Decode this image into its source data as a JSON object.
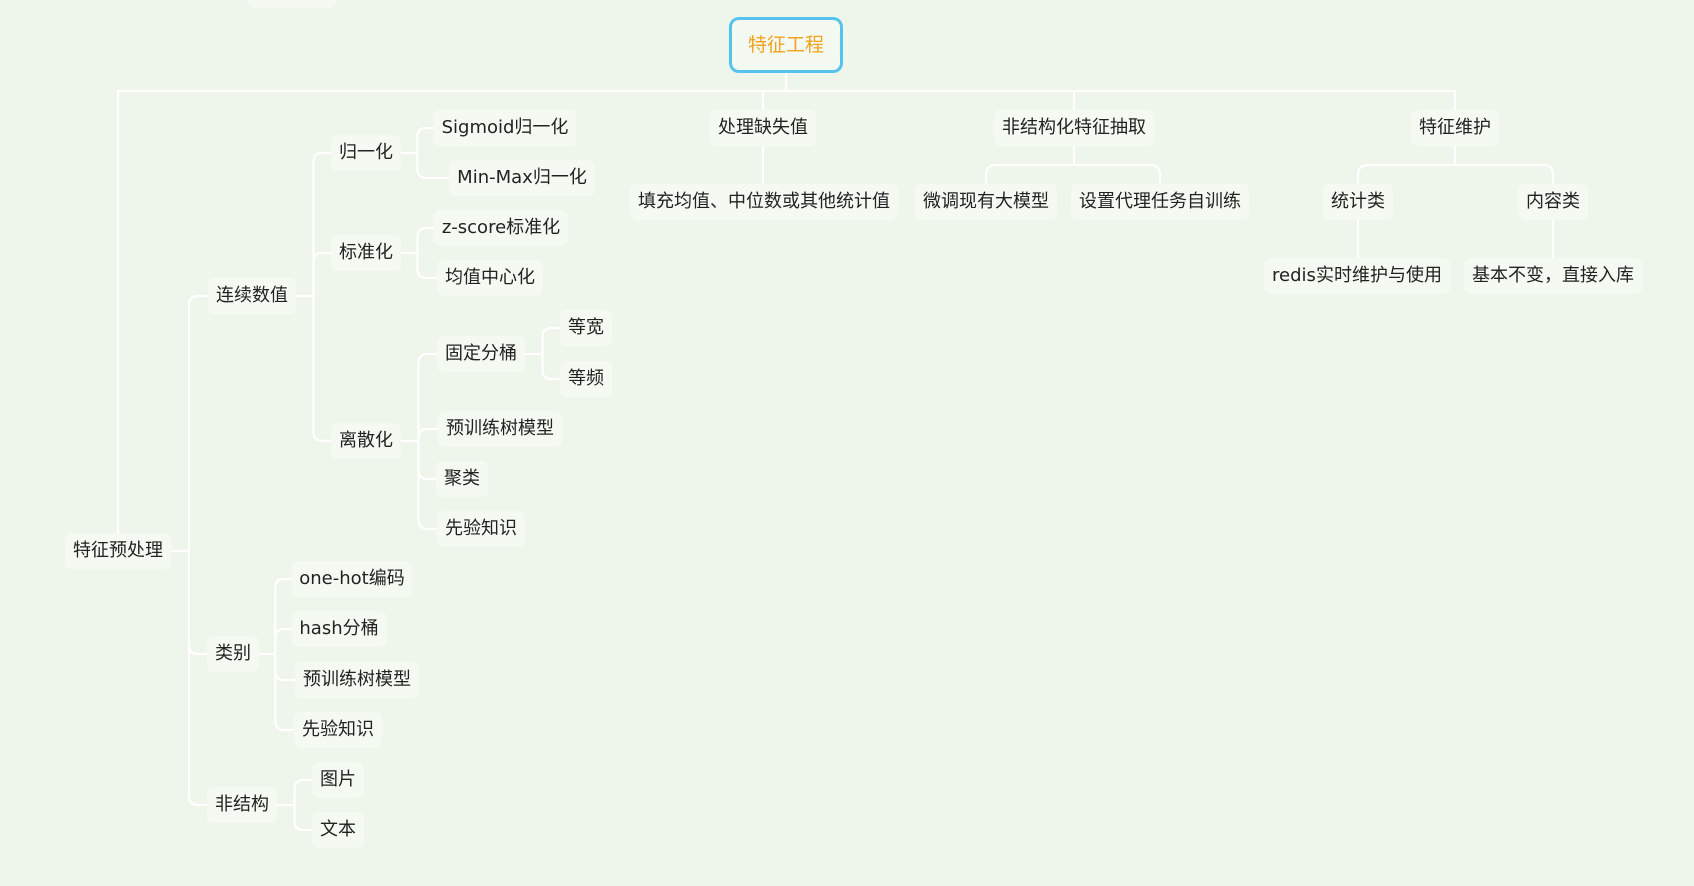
{
  "mindmap": {
    "root": "特征工程",
    "nodes": [
      {
        "id": "root",
        "label": "特征工程",
        "root": true
      },
      {
        "id": "pre",
        "label": "特征预处理",
        "parent": "root"
      },
      {
        "id": "cont",
        "label": "连续数值",
        "parent": "pre"
      },
      {
        "id": "norm",
        "label": "归一化",
        "parent": "cont"
      },
      {
        "id": "sig",
        "label": "Sigmoid归一化",
        "parent": "norm"
      },
      {
        "id": "minmax",
        "label": "Min-Max归一化",
        "parent": "norm"
      },
      {
        "id": "std",
        "label": "标准化",
        "parent": "cont"
      },
      {
        "id": "zscore",
        "label": "z-score标准化",
        "parent": "std"
      },
      {
        "id": "center",
        "label": "均值中心化",
        "parent": "std"
      },
      {
        "id": "disc",
        "label": "离散化",
        "parent": "cont"
      },
      {
        "id": "fixbin",
        "label": "固定分桶",
        "parent": "disc"
      },
      {
        "id": "eqw",
        "label": "等宽",
        "parent": "fixbin"
      },
      {
        "id": "eqf",
        "label": "等频",
        "parent": "fixbin"
      },
      {
        "id": "tree1",
        "label": "预训练树模型",
        "parent": "disc"
      },
      {
        "id": "cluster",
        "label": "聚类",
        "parent": "disc"
      },
      {
        "id": "prior1",
        "label": "先验知识",
        "parent": "disc"
      },
      {
        "id": "cat",
        "label": "类别",
        "parent": "pre"
      },
      {
        "id": "onehot",
        "label": "one-hot编码",
        "parent": "cat"
      },
      {
        "id": "hash",
        "label": "hash分桶",
        "parent": "cat"
      },
      {
        "id": "tree2",
        "label": "预训练树模型",
        "parent": "cat"
      },
      {
        "id": "prior2",
        "label": "先验知识",
        "parent": "cat"
      },
      {
        "id": "unstr",
        "label": "非结构",
        "parent": "pre"
      },
      {
        "id": "img",
        "label": "图片",
        "parent": "unstr"
      },
      {
        "id": "txt",
        "label": "文本",
        "parent": "unstr"
      },
      {
        "id": "missing",
        "label": "处理缺失值",
        "parent": "root"
      },
      {
        "id": "fill",
        "label": "填充均值、中位数或其他统计值",
        "parent": "missing"
      },
      {
        "id": "extract",
        "label": "非结构化特征抽取",
        "parent": "root"
      },
      {
        "id": "finetune",
        "label": "微调现有大模型",
        "parent": "extract"
      },
      {
        "id": "proxy",
        "label": "设置代理任务自训练",
        "parent": "extract"
      },
      {
        "id": "maint",
        "label": "特征维护",
        "parent": "root"
      },
      {
        "id": "stat",
        "label": "统计类",
        "parent": "maint"
      },
      {
        "id": "redis",
        "label": "redis实时维护与使用",
        "parent": "stat"
      },
      {
        "id": "content",
        "label": "内容类",
        "parent": "maint"
      },
      {
        "id": "stable",
        "label": "基本不变，直接入库",
        "parent": "content"
      }
    ]
  },
  "colors": {
    "background": "#eef5ea",
    "node_fill": "#f4f9f1",
    "line": "#ffffff",
    "root_border": "#55c3ee",
    "root_text": "#f2a21c",
    "text": "#222222"
  }
}
